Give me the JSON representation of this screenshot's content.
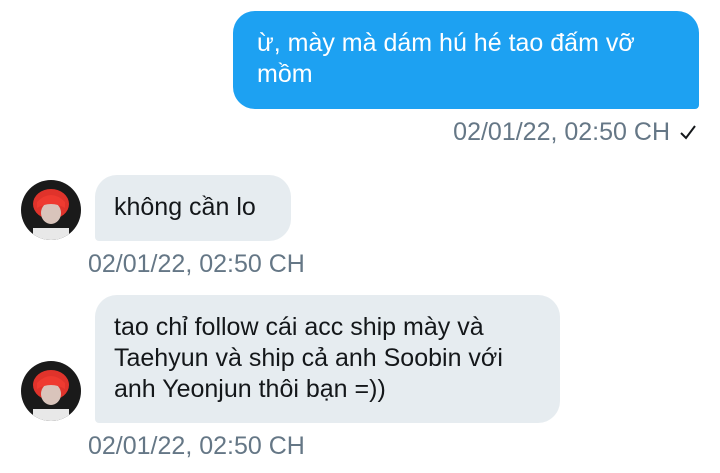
{
  "messages": [
    {
      "direction": "sent",
      "text": "ừ, mày mà dám hú hé tao đấm vỡ\nmồm",
      "timestamp": "02/01/22, 02:50 CH",
      "status_icon": "check-icon"
    },
    {
      "direction": "received",
      "text": "không cần lo",
      "timestamp": "02/01/22, 02:50 CH",
      "avatar_icon": "avatar-red-hair"
    },
    {
      "direction": "received",
      "text": "tao chỉ follow cái acc ship mày và\nTaehyun và ship cả anh Soobin với\nanh Yeonjun thôi bạn =))",
      "timestamp": "02/01/22, 02:50 CH",
      "avatar_icon": "avatar-red-hair"
    }
  ],
  "colors": {
    "sent_bubble": "#1da1f2",
    "received_bubble": "#e6ecf0",
    "timestamp": "#657786"
  }
}
